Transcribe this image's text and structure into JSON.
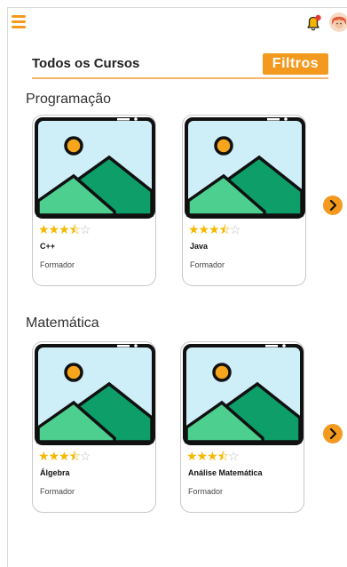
{
  "header": {
    "menu_icon": "hamburger-icon",
    "bell_icon": "bell-icon",
    "avatar_icon": "avatar-icon"
  },
  "page": {
    "title": "Todos os Cursos",
    "filter_label": "Filtros"
  },
  "sections": [
    {
      "label": "Programação",
      "courses": [
        {
          "name": "C++",
          "role": "Formador",
          "rating": 3.5
        },
        {
          "name": "Java",
          "role": "Formador",
          "rating": 3.5
        }
      ]
    },
    {
      "label": "Matemática",
      "courses": [
        {
          "name": "Álgebra",
          "role": "Formador",
          "rating": 3.5
        },
        {
          "name": "Análise Matemática",
          "role": "Formador",
          "rating": 3.5
        }
      ]
    }
  ],
  "colors": {
    "accent": "#f39a1e",
    "star": "#f5b800"
  }
}
